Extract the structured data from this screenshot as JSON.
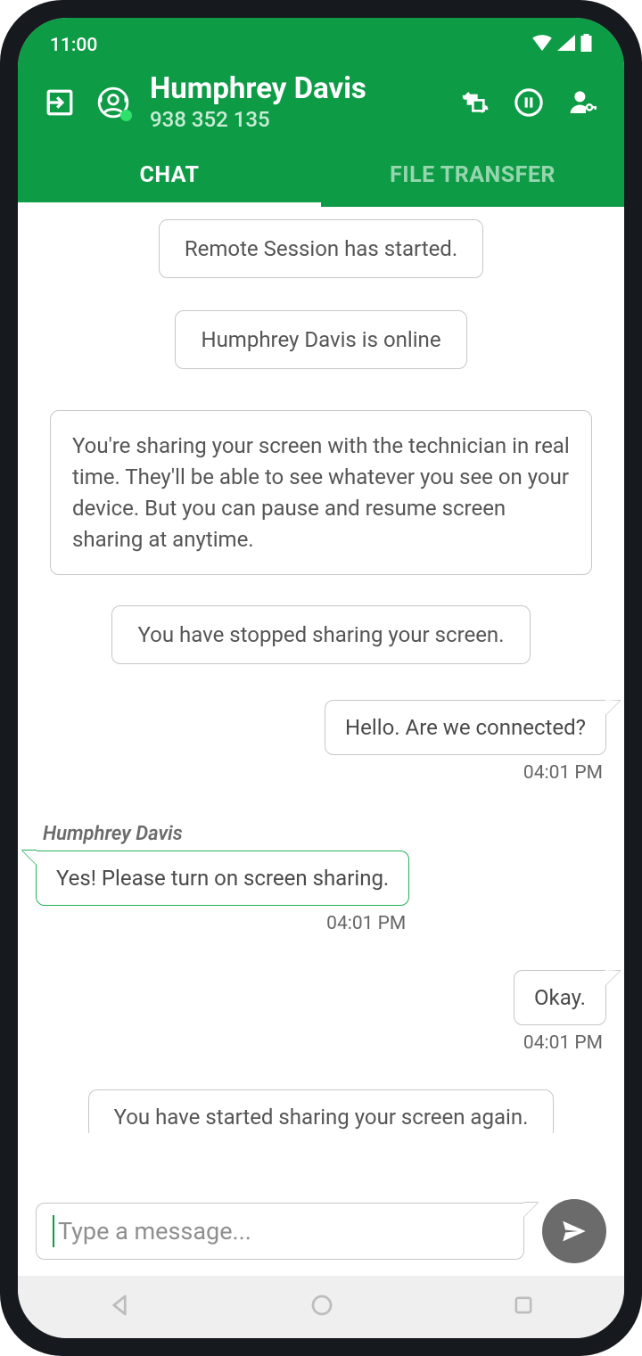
{
  "status": {
    "time": "11:00"
  },
  "header": {
    "title": "Humphrey Davis",
    "subtitle": "938 352 135"
  },
  "tabs": {
    "chat": "CHAT",
    "file_transfer": "FILE TRANSFER"
  },
  "messages": {
    "sys_session_started": "Remote Session has started.",
    "sys_user_online": "Humphrey Davis is online",
    "sys_sharing_info": "You're sharing your screen with the technician in real time. They'll be able to see whatever you see on your device. But you can pause and resume screen sharing at anytime.",
    "sys_stopped_sharing": "You have stopped sharing your screen.",
    "out_hello": {
      "text": "Hello. Are we connected?",
      "time": "04:01 PM"
    },
    "in_msg": {
      "sender": "Humphrey Davis",
      "text": "Yes! Please turn on screen sharing.",
      "time": "04:01 PM"
    },
    "out_okay": {
      "text": "Okay.",
      "time": "04:01 PM"
    },
    "sys_started_again": "You have started sharing your screen again."
  },
  "composer": {
    "placeholder": "Type a message..."
  }
}
